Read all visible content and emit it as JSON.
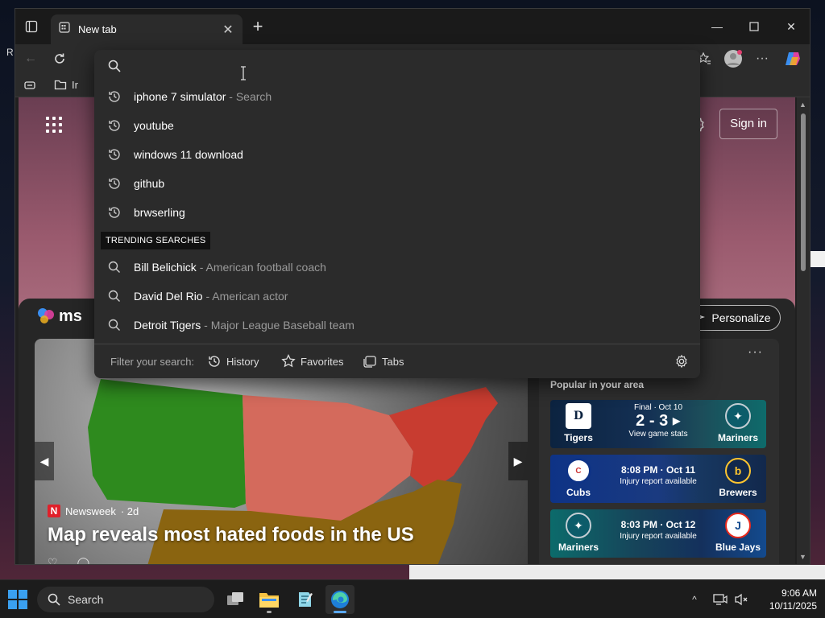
{
  "desktop": {
    "label_fragment": "R"
  },
  "browser": {
    "tab_title": "New tab",
    "favorites_bar": {
      "item_label": "Ir"
    },
    "ntp": {
      "sign_in_label": "Sign in",
      "msn_brand": "ms",
      "personalize_label": "Personalize",
      "hero": {
        "source": "Newsweek",
        "age": "· 2d",
        "title": "Map reveals most hated foods in the US"
      },
      "sports": {
        "heading": "Popular in your area",
        "games": [
          {
            "home": "Tigers",
            "away": "Mariners",
            "status": "Final · Oct 10",
            "score": "2 - 3",
            "detail": "View game stats"
          },
          {
            "home": "Cubs",
            "away": "Brewers",
            "time": "8:08 PM · Oct 11",
            "detail": "Injury report available"
          },
          {
            "home": "Mariners",
            "away": "Blue Jays",
            "time": "8:03 PM · Oct 12",
            "detail": "Injury report available"
          }
        ]
      }
    },
    "omnibox": {
      "query": "",
      "history": [
        {
          "text": "iphone 7 simulator",
          "sub": " - Search"
        },
        {
          "text": "youtube",
          "sub": ""
        },
        {
          "text": "windows 11 download",
          "sub": ""
        },
        {
          "text": "github",
          "sub": ""
        },
        {
          "text": "brwserling",
          "sub": ""
        }
      ],
      "trending_label": "TRENDING SEARCHES",
      "trending": [
        {
          "text": "Bill Belichick",
          "sub": " - American football coach"
        },
        {
          "text": "David Del Rio",
          "sub": " - American actor"
        },
        {
          "text": "Detroit Tigers",
          "sub": " - Major League Baseball team"
        }
      ],
      "filter": {
        "label": "Filter your search:",
        "history": "History",
        "favorites": "Favorites",
        "tabs": "Tabs"
      }
    }
  },
  "taskbar": {
    "search_label": "Search",
    "time": "9:06 AM",
    "date": "10/11/2025"
  },
  "colors": {
    "accent": "#5aa8f0",
    "omnibox_bg": "#2b2b2b",
    "subtext": "#9a9a9a"
  }
}
